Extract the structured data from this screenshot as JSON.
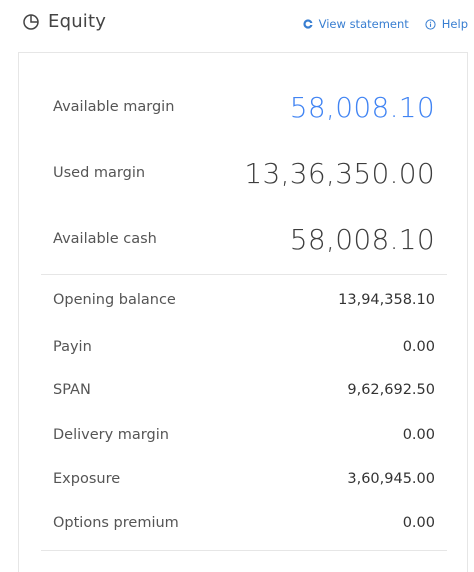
{
  "header": {
    "title": "Equity",
    "view_statement": "View statement",
    "help": "Help"
  },
  "summary": [
    {
      "label": "Available margin",
      "value": "58,008.10",
      "highlight": true
    },
    {
      "label": "Used margin",
      "value": "13,36,350.00",
      "highlight": false
    },
    {
      "label": "Available cash",
      "value": "58,008.10",
      "highlight": false
    }
  ],
  "details": [
    {
      "label": "Opening balance",
      "value": "13,94,358.10"
    },
    {
      "label": "Payin",
      "value": "0.00"
    },
    {
      "label": "SPAN",
      "value": "9,62,692.50"
    },
    {
      "label": "Delivery margin",
      "value": "0.00"
    },
    {
      "label": "Exposure",
      "value": "3,60,945.00"
    },
    {
      "label": "Options premium",
      "value": "0.00"
    }
  ],
  "colors": {
    "accent": "#387ed1",
    "highlight_value": "#4184f3"
  }
}
